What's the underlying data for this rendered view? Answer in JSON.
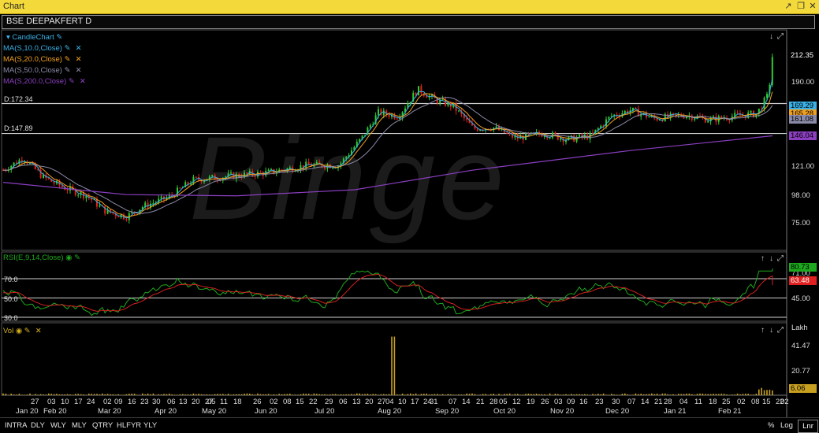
{
  "window": {
    "title": "Chart"
  },
  "symbol": {
    "text": "BSE DEEPAKFERT D"
  },
  "watermark": {
    "text": "Binge"
  },
  "legend": [
    {
      "label": "CandleChart",
      "color": "#3ab0e6"
    },
    {
      "label": "MA(S,10.0,Close)",
      "color": "#3ab0e6"
    },
    {
      "label": "MA(S,20.0,Close)",
      "color": "#f0a020"
    },
    {
      "label": "MA(S,50.0,Close)",
      "color": "#8a8aa8"
    },
    {
      "label": "MA(S,200.0,Close)",
      "color": "#8b3fc0"
    }
  ],
  "price_lines": [
    {
      "label": "D:172.34",
      "value": 172.34
    },
    {
      "label": "D:147.89",
      "value": 147.89
    }
  ],
  "price_axis": {
    "ticks": [
      "190.00",
      "121.00",
      "98.00",
      "75.00"
    ],
    "tick_values": [
      190,
      121,
      98,
      75
    ],
    "badges": [
      {
        "text": "212.35",
        "bg": "#000",
        "fg": "#fff",
        "value": 212.35
      },
      {
        "text": "169.29",
        "bg": "#3ab0e6",
        "fg": "#000",
        "value": 169.29
      },
      {
        "text": "165.28",
        "bg": "#f0a020",
        "fg": "#000",
        "value": 165.28
      },
      {
        "text": "161.08",
        "bg": "#8a8aa8",
        "fg": "#000",
        "value": 161.08
      },
      {
        "text": "146.04",
        "bg": "#8b3fc0",
        "fg": "#000",
        "value": 146.04
      }
    ]
  },
  "rsi": {
    "label": "RSI(E,9,14,Close)",
    "levels": [
      "70.0",
      "50.0",
      "30.0"
    ],
    "level_values": [
      70,
      50,
      30
    ],
    "ticks": [
      "71.00",
      "45.00"
    ],
    "tick_values": [
      71,
      45
    ],
    "badges": [
      {
        "text": "80.73",
        "bg": "#1ea81e",
        "fg": "#000",
        "value": 80.73
      },
      {
        "text": "63.48",
        "bg": "#e02020",
        "fg": "#fff",
        "value": 63.48
      }
    ]
  },
  "vol": {
    "label": "Vol",
    "unit": "Lakh",
    "ticks": [
      "41.47",
      "20.77"
    ],
    "tick_values": [
      41.47,
      20.77
    ],
    "badge": {
      "text": "6.06",
      "bg": "#c8a020",
      "fg": "#000",
      "value": 6.06
    }
  },
  "x_axis": {
    "days": [
      "27",
      "03",
      "10",
      "17",
      "24",
      "02",
      "09",
      "16",
      "23",
      "30",
      "06",
      "13",
      "20",
      "27",
      "05",
      "11",
      "18",
      "26",
      "02",
      "08",
      "15",
      "22",
      "29",
      "06",
      "13",
      "20",
      "27",
      "04",
      "10",
      "17",
      "24",
      "31",
      "07",
      "14",
      "21",
      "28",
      "05",
      "12",
      "19",
      "26",
      "03",
      "09",
      "16",
      "23",
      "30",
      "07",
      "14",
      "21",
      "28",
      "04",
      "11",
      "18",
      "25",
      "02",
      "08",
      "15",
      "22",
      "02"
    ],
    "months": [
      "Jan 20",
      "Feb 20",
      "Mar 20",
      "Apr 20",
      "May 20",
      "Jun 20",
      "Jul 20",
      "Aug 20",
      "Sep 20",
      "Oct 20",
      "Nov 20",
      "Dec 20",
      "Jan 21",
      "Feb 21"
    ]
  },
  "bottom_bar": {
    "periods": [
      "INTRA",
      "DLY",
      "WLY",
      "MLY",
      "QTRY",
      "HLFYR",
      "YLY"
    ],
    "right": [
      "%",
      "Log",
      "Lnr"
    ],
    "active": "Lnr"
  }
}
